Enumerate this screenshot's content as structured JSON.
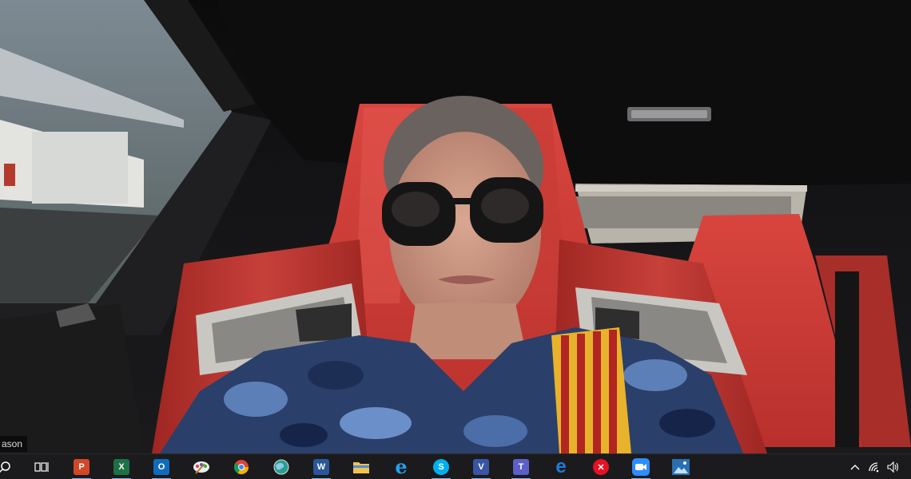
{
  "video": {
    "participant_name": "ason"
  },
  "taskbar": {
    "items": [
      {
        "id": "search",
        "icon": "search-icon"
      },
      {
        "id": "task-view",
        "icon": "task-view-icon"
      },
      {
        "id": "powerpoint",
        "icon": "powerpoint-icon",
        "glyph": "P",
        "color": "#d24726"
      },
      {
        "id": "excel",
        "icon": "excel-icon",
        "glyph": "X",
        "color": "#1e7145"
      },
      {
        "id": "outlook",
        "icon": "outlook-icon",
        "glyph": "O",
        "color": "#0f6cbd"
      },
      {
        "id": "paint",
        "icon": "paint-icon"
      },
      {
        "id": "chrome",
        "icon": "chrome-icon"
      },
      {
        "id": "network",
        "icon": "globe-icon"
      },
      {
        "id": "word",
        "icon": "word-icon",
        "glyph": "W",
        "color": "#2b579a"
      },
      {
        "id": "file-explorer",
        "icon": "folder-icon",
        "color": "#f2c14e"
      },
      {
        "id": "internet-explorer",
        "icon": "internet-explorer-icon",
        "glyph": "e",
        "color": "#1ea1f1"
      },
      {
        "id": "skype",
        "icon": "skype-icon",
        "glyph": "S",
        "color": "#00aff0"
      },
      {
        "id": "visio",
        "icon": "visio-icon",
        "glyph": "V",
        "color": "#3955a3"
      },
      {
        "id": "teams",
        "icon": "teams-icon",
        "glyph": "T",
        "color": "#5b5fc7"
      },
      {
        "id": "edge",
        "icon": "edge-icon",
        "glyph": "e",
        "color": "#1f7ad8"
      },
      {
        "id": "close-app",
        "icon": "close-icon",
        "glyph": "✕",
        "color": "#e81123"
      },
      {
        "id": "zoom",
        "icon": "zoom-icon",
        "color": "#2d8cff"
      },
      {
        "id": "photos",
        "icon": "photos-icon",
        "color": "#2a6fb0"
      }
    ],
    "tray": [
      {
        "id": "show-hidden",
        "icon": "chevron-up-icon",
        "glyph": "^"
      },
      {
        "id": "wifi",
        "icon": "wifi-icon"
      },
      {
        "id": "volume",
        "icon": "volume-icon",
        "glyph": "🔊"
      }
    ]
  }
}
